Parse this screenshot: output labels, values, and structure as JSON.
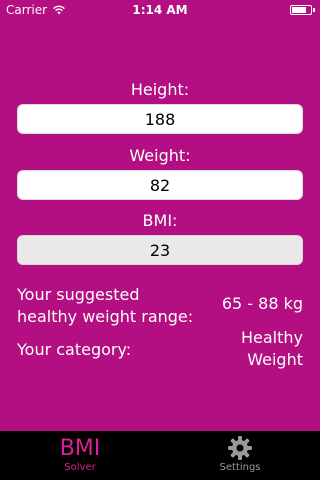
{
  "status_bar": {
    "carrier": "Carrier",
    "time": "1:14 AM",
    "wifi_icon": "wifi-icon",
    "battery_icon": "battery-icon",
    "battery_level": 0.8
  },
  "form": {
    "height_label": "Height:",
    "height_value": "188",
    "weight_label": "Weight:",
    "weight_value": "82",
    "bmi_label": "BMI:",
    "bmi_value": "23"
  },
  "results": {
    "suggested_label_line1": "Your suggested",
    "suggested_label_line2": "healthy weight range:",
    "suggested_value": "65 - 88 kg",
    "category_label": "Your category:",
    "category_value_line1": "Healthy",
    "category_value_line2": "Weight"
  },
  "tab_bar": {
    "tabs": [
      {
        "icon_text": "BMI",
        "label": "Solver",
        "active": true
      },
      {
        "icon": "gear-icon",
        "label": "Settings",
        "active": false
      }
    ]
  },
  "colors": {
    "background": "#b30f82",
    "active_tab": "#e01d96",
    "inactive_tab": "#9a9a9a"
  }
}
